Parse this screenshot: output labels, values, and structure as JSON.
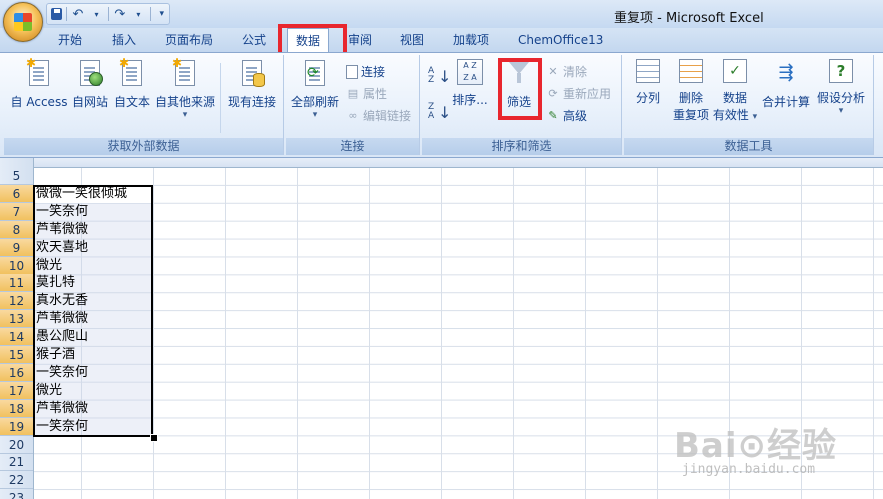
{
  "window": {
    "title": "重复项 - Microsoft Excel"
  },
  "tabs": [
    {
      "label": "开始"
    },
    {
      "label": "插入"
    },
    {
      "label": "页面布局"
    },
    {
      "label": "公式"
    },
    {
      "label": "数据",
      "active": true
    },
    {
      "label": "审阅"
    },
    {
      "label": "视图"
    },
    {
      "label": "加载项"
    },
    {
      "label": "ChemOffice13"
    }
  ],
  "ribbon": {
    "external": {
      "group_label": "获取外部数据",
      "access": "自 Access",
      "web": "自网站",
      "text": "自文本",
      "other": "自其他来源",
      "existing": "现有连接"
    },
    "connections": {
      "group_label": "连接",
      "refresh_all": "全部刷新",
      "connections": "连接",
      "properties": "属性",
      "edit_links": "编辑链接"
    },
    "sort_filter": {
      "group_label": "排序和筛选",
      "sort": "排序...",
      "filter": "筛选",
      "clear": "清除",
      "reapply": "重新应用",
      "advanced": "高级",
      "az_top": "A",
      "az_bottom": "Z",
      "za_top": "Z",
      "za_bottom": "A"
    },
    "data_tools": {
      "group_label": "数据工具",
      "text_to_columns": "分列",
      "remove_dup_l1": "删除",
      "remove_dup_l2": "重复项",
      "validation_l1": "数据",
      "validation_l2": "有效性",
      "consolidate": "合并计算",
      "what_if": "假设分析"
    }
  },
  "sheet": {
    "rows": [
      {
        "n": "5",
        "text": ""
      },
      {
        "n": "6",
        "text": "微微一笑很倾城"
      },
      {
        "n": "7",
        "text": "一笑奈何"
      },
      {
        "n": "8",
        "text": "芦苇微微"
      },
      {
        "n": "9",
        "text": "欢天喜地"
      },
      {
        "n": "10",
        "text": "微光"
      },
      {
        "n": "11",
        "text": "莫扎特"
      },
      {
        "n": "12",
        "text": "真水无香"
      },
      {
        "n": "13",
        "text": "芦苇微微"
      },
      {
        "n": "14",
        "text": "愚公爬山"
      },
      {
        "n": "15",
        "text": "猴子酒"
      },
      {
        "n": "16",
        "text": "一笑奈何"
      },
      {
        "n": "17",
        "text": "微光"
      },
      {
        "n": "18",
        "text": "芦苇微微"
      },
      {
        "n": "19",
        "text": "一笑奈何"
      },
      {
        "n": "20",
        "text": ""
      },
      {
        "n": "21",
        "text": ""
      },
      {
        "n": "22",
        "text": ""
      },
      {
        "n": "23",
        "text": ""
      }
    ]
  },
  "watermark": {
    "logo": "Bai⊙经验",
    "url": "jingyan.baidu.com"
  },
  "colors": {
    "highlight": "#e8262e",
    "ribbon_text": "#15428b"
  }
}
